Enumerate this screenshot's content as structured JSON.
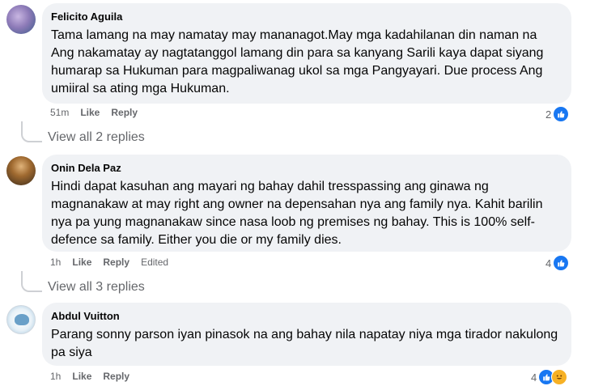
{
  "comments": [
    {
      "author": "Felicito Aguila",
      "text": "Tama lamang na may namatay may mananagot.May mga kadahilanan din naman na\nAng nakamatay ay nagtatanggol lamang din para sa kanyang Sarili kaya dapat siyang\nhumarap sa Hukuman para magpaliwanag ukol sa mga Pangyayari. Due process Ang\numiiral sa ating mga Hukuman.",
      "time": "51m",
      "like": "Like",
      "reply": "Reply",
      "reactions": "2",
      "view_replies": "View all 2 replies"
    },
    {
      "author": "Onin Dela Paz",
      "text": "Hindi dapat kasuhan ang mayari ng bahay dahil tresspassing ang ginawa ng\nmagnanakaw at may right ang owner na depensahan nya ang family nya. Kahit barilin\nnya pa yung magnanakaw since nasa loob ng premises ng bahay. This is 100% self-\ndefence sa family. Either you die or my family dies.",
      "time": "1h",
      "like": "Like",
      "reply": "Reply",
      "edited": "Edited",
      "reactions": "4",
      "view_replies": "View all 3 replies"
    },
    {
      "author": "Abdul Vuitton",
      "text": "Parang sonny parson iyan pinasok na ang bahay nila napatay niya mga tirador nakulong\npa siya",
      "time": "1h",
      "like": "Like",
      "reply": "Reply",
      "reactions": "4"
    }
  ],
  "colors": {
    "bubble": "#f0f2f5",
    "meta": "#65676b",
    "like_blue": "#1877f2"
  },
  "icons": [
    "like-icon",
    "haha-icon"
  ]
}
